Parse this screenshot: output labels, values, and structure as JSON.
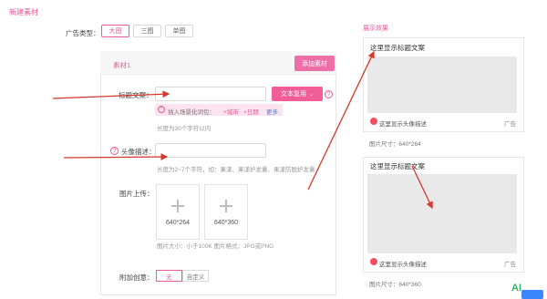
{
  "header": {
    "title": "新建素材"
  },
  "ad_type": {
    "label": "广告类型：",
    "options": [
      "大图",
      "三图",
      "单图"
    ],
    "selected": "大图"
  },
  "material": {
    "title": "素材1",
    "add_button": "添加素材",
    "title_field": {
      "label": "标题文案：",
      "value": "",
      "dynamic_button": "文本复用",
      "hint_prefix": "插入场景化词包：",
      "hint_city": "+城市",
      "hint_date": "+日期",
      "hint_more": "更多",
      "length_note": "长度为30个字符以内"
    },
    "avatar_field": {
      "label": "头像描述：",
      "value": "",
      "length_note": "长度为2~7个字符，如：果漾、果漾护发囊、果漾防脱护发囊"
    },
    "image_upload": {
      "label": "图片上传：",
      "slots": [
        "640*264",
        "640*360"
      ],
      "note": "图片大小：小于100K 图片格式：JPG或PNG"
    },
    "extra": {
      "label": "附加创意：",
      "options": [
        "无",
        "自定义"
      ],
      "selected": "无"
    }
  },
  "preview": {
    "title": "展示效果",
    "cards": [
      {
        "headline": "这里显示标题文案",
        "desc": "这里显示头像描述",
        "ad": "广告",
        "size": "图片尺寸：640*264"
      },
      {
        "headline": "这里显示标题文案",
        "desc": "这里显示头像描述",
        "ad": "广告",
        "size": "图片尺寸：640*360"
      }
    ]
  },
  "watermark": {
    "text": "AI"
  },
  "colors": {
    "accent": "#e85a9a",
    "button": "#ee6ea8",
    "arrow": "#d33a2c"
  }
}
